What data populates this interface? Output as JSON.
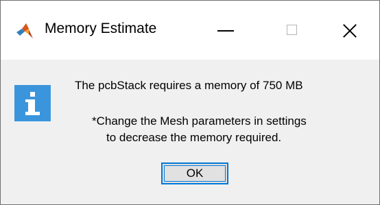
{
  "window": {
    "title": "Memory Estimate",
    "icon": "matlab-icon"
  },
  "controls": {
    "minimize": "minimize-icon",
    "maximize": "maximize-icon",
    "close": "close-icon"
  },
  "dialog": {
    "icon": "info-icon",
    "message_line1": "The pcbStack requires a memory of 750 MB",
    "message_line2": "*Change the Mesh parameters in settings",
    "message_line3": "to decrease the memory required.",
    "ok_label": "OK"
  },
  "colors": {
    "accent": "#0078d7",
    "info_icon": "#3b95dc"
  }
}
